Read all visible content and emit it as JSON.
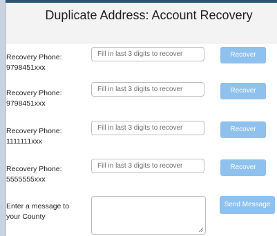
{
  "header": {
    "title": "Duplicate Address: Account Recovery"
  },
  "recovery_rows": [
    {
      "label": "Recovery Phone:",
      "phone": "9798451xxx",
      "placeholder": "Fill in last 3 digits to recover",
      "button": "Recover"
    },
    {
      "label": "Recovery Phone:",
      "phone": "9798451xxx",
      "placeholder": "Fill in last 3 digits to recover",
      "button": "Recover"
    },
    {
      "label": "Recovery Phone:",
      "phone": "1111111xxx",
      "placeholder": "Fill in last 3 digits to recover",
      "button": "Recover"
    },
    {
      "label": "Recovery Phone:",
      "phone": "5555555xxx",
      "placeholder": "Fill in last 3 digits to recover",
      "button": "Recover"
    }
  ],
  "message": {
    "label_line1": "Enter a message to",
    "label_line2": "your County",
    "button": "Send Message"
  },
  "colors": {
    "button": "#8fc1ee",
    "accent_bar": "#2a5570"
  }
}
